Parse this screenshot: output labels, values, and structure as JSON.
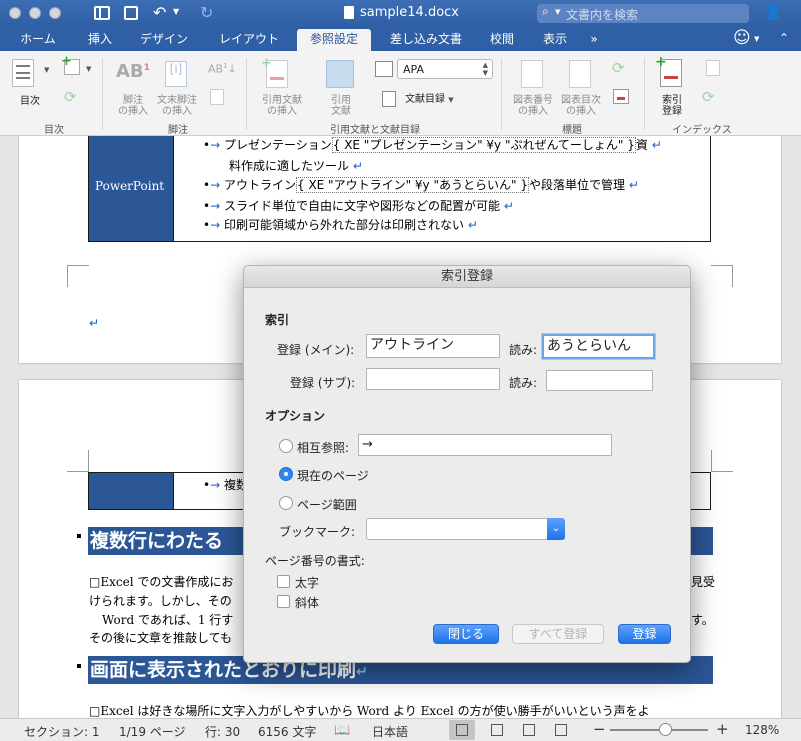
{
  "window": {
    "title": "sample14.docx",
    "search_placeholder": "文書内を検索"
  },
  "tabs": [
    "ホーム",
    "挿入",
    "デザイン",
    "レイアウト",
    "参照設定",
    "差し込み文書",
    "校閲",
    "表示"
  ],
  "ribbon": {
    "toc_label": "目次",
    "footnote_label": "脚注\nの挿入",
    "endnote_label": "文末脚注\nの挿入",
    "citation_label": "引用文献\nの挿入",
    "source_label": "引用\n文献",
    "style_value": "APA",
    "bibliography_label": "文献目録",
    "caption_label": "図表番号\nの挿入",
    "tof_label": "図表目次\nの挿入",
    "mark_entry_label": "索引\n登録",
    "group_toc": "目次",
    "group_footnotes": "脚注",
    "group_citations": "引用文献と文献目録",
    "group_captions": "標題",
    "group_index": "インデックス"
  },
  "document": {
    "table_label": "PowerPoint",
    "bullets": [
      {
        "pre": "プレゼンテーション",
        "xe": " XE \"プレゼンテーション\" ¥y \"ぷれぜんてーしょん\" ",
        "post": "資"
      },
      {
        "pre": "料作成に適したツール",
        "xe": "",
        "post": ""
      },
      {
        "pre": "アウトライン",
        "xe": " XE \"アウトライン\" ¥y \"あうとらいん\" ",
        "post": "や段落単位で管理"
      },
      {
        "pre": "スライド単位で自由に文字や図形などの配置が可能",
        "xe": "",
        "post": ""
      },
      {
        "pre": "印刷可能領域から外れた部分は印刷されない",
        "xe": "",
        "post": ""
      }
    ],
    "page2_bullet": "複数",
    "heading1": "複数行にわたる",
    "para1_line1": "□Excel での文書作成にお",
    "para1_line1_tail": "見受",
    "para1_line2": "けられます。しかし、その",
    "para1_line3": "Word であれば、1 行す",
    "para1_line3_tail": "す。",
    "para1_line4": "その後に文章を推敲しても",
    "heading2": "画面に表示されたとおりに印刷",
    "para2": "□Excel は好きな場所に文字入力がしやすいから Word より Excel の方が使い勝手がいいという声をよ"
  },
  "dialog": {
    "title": "索引登録",
    "section_index": "索引",
    "main_label": "登録 (メイン):",
    "main_value": "アウトライン",
    "reading_label": "読み:",
    "main_reading": "あうとらいん",
    "sub_label": "登録 (サブ):",
    "sub_value": "",
    "sub_reading": "",
    "section_options": "オプション",
    "opt_crossref": "相互参照:",
    "crossref_value": "→",
    "opt_current": "現在のページ",
    "opt_range": "ページ範囲",
    "bookmark_label": "ブックマーク:",
    "bookmark_value": "",
    "section_format": "ページ番号の書式:",
    "bold": "太字",
    "italic": "斜体",
    "close": "閉じる",
    "mark_all": "すべて登録",
    "mark": "登録"
  },
  "status": {
    "section": "セクション: 1",
    "page": "1/19 ページ",
    "line": "行: 30",
    "words": "6156 文字",
    "language": "日本語",
    "zoom": "128%"
  }
}
